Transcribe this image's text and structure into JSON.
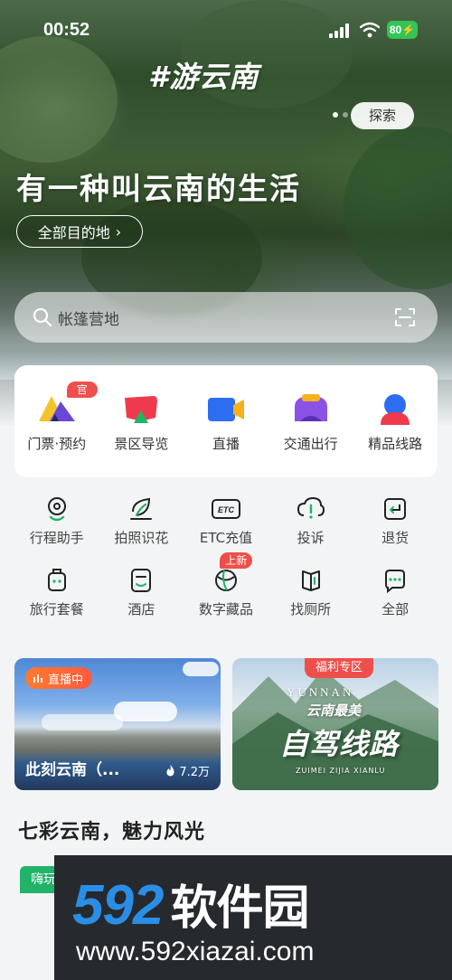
{
  "status_bar": {
    "time": "00:52",
    "battery": "80"
  },
  "hero": {
    "hashtag": "#游云南",
    "explore_label": "探索",
    "slogan": "有一种叫云南的生活",
    "destinations_label": "全部目的地",
    "destinations_chevron": "›"
  },
  "search": {
    "placeholder": "帐篷营地"
  },
  "primary_nav": {
    "items": [
      {
        "label": "门票·预约",
        "badge": "官方",
        "icon": "ticket-icon"
      },
      {
        "label": "景区导览",
        "icon": "map-guide-icon"
      },
      {
        "label": "直播",
        "icon": "live-camera-icon"
      },
      {
        "label": "交通出行",
        "icon": "transport-icon"
      },
      {
        "label": "精品线路",
        "icon": "route-icon"
      }
    ]
  },
  "secondary_nav": {
    "items": [
      {
        "label": "行程助手",
        "icon": "itinerary-icon"
      },
      {
        "label": "拍照识花",
        "icon": "flower-scan-icon"
      },
      {
        "label": "ETC充值",
        "icon": "etc-icon",
        "icon_text": "ETC"
      },
      {
        "label": "投诉",
        "icon": "complaint-icon"
      },
      {
        "label": "退货",
        "icon": "return-icon"
      },
      {
        "label": "旅行套餐",
        "icon": "luggage-icon"
      },
      {
        "label": "酒店",
        "icon": "hotel-icon"
      },
      {
        "label": "数字藏品",
        "icon": "digital-collection-icon",
        "badge": "上新"
      },
      {
        "label": "找厕所",
        "icon": "restroom-icon"
      },
      {
        "label": "全部",
        "icon": "all-icon"
      }
    ]
  },
  "live_card": {
    "tag": "直播中",
    "title": "此刻云南（...",
    "views": "7.2万"
  },
  "promo_card": {
    "tag": "福利专区",
    "small": "YUNNAN",
    "sub": "云南最美",
    "main": "自驾线路",
    "pinyin": "ZUIMEI ZIJIA XIANLU"
  },
  "section": {
    "title": "七彩云南，魅力风光",
    "peek_tag": "嗨玩"
  },
  "watermark": {
    "logo_num": "592",
    "logo_text": "软件园",
    "url": "www.592xiazai.com"
  },
  "colors": {
    "accent_green": "#1fb36a",
    "badge_red": "#ef4f4a",
    "live_orange": "#ff6a35"
  }
}
